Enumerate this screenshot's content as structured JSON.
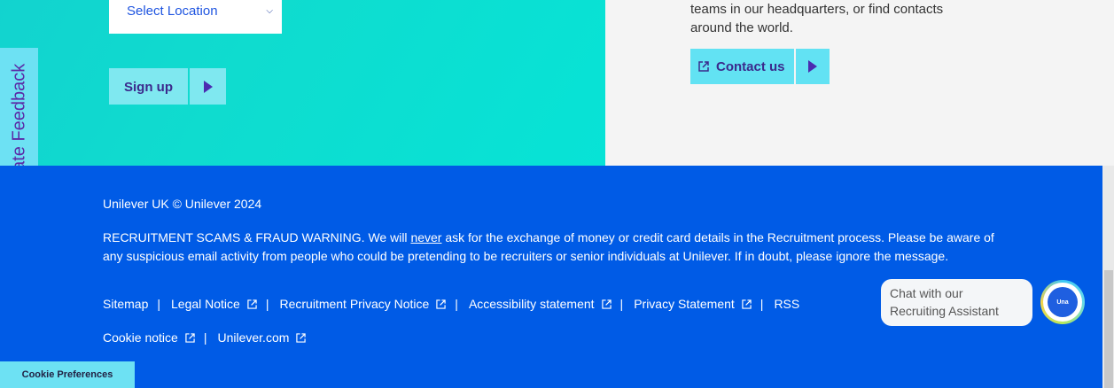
{
  "location_select": {
    "value": "Select Location"
  },
  "signup_button": {
    "label": "Sign up"
  },
  "contact_section": {
    "line1": "teams in our headquarters, or find contacts",
    "line2": "around the world.",
    "button_label": "Contact us"
  },
  "feedback_tab": {
    "label": "Candidate Feedback"
  },
  "footer": {
    "copyright": "Unilever UK © Unilever 2024",
    "warning_prefix": "RECRUITMENT SCAMS & FRAUD WARNING. We will ",
    "warning_emphasis": "never",
    "warning_suffix": " ask for the exchange of money or credit card details in the Recruitment process. Please be aware of any suspicious email activity from people who could be pretending to be recruiters or senior individuals at Unilever. If in doubt, please ignore the message.",
    "links_row1": [
      "Sitemap",
      "Legal Notice",
      "Recruitment Privacy Notice",
      "Accessibility statement",
      "Privacy Statement",
      "RSS"
    ],
    "links_row2": [
      "Cookie notice",
      "Unilever.com"
    ],
    "separator": "|"
  },
  "chat": {
    "line1": "Chat with our",
    "line2": "Recruiting Assistant",
    "avatar_text": "Una"
  },
  "cookie_button": {
    "label": "Cookie Preferences"
  },
  "colors": {
    "footer_bg": "#005be6",
    "teal": "#12d3cf",
    "button_cyan": "#62e2f3",
    "button_text": "#3b2a8c"
  }
}
